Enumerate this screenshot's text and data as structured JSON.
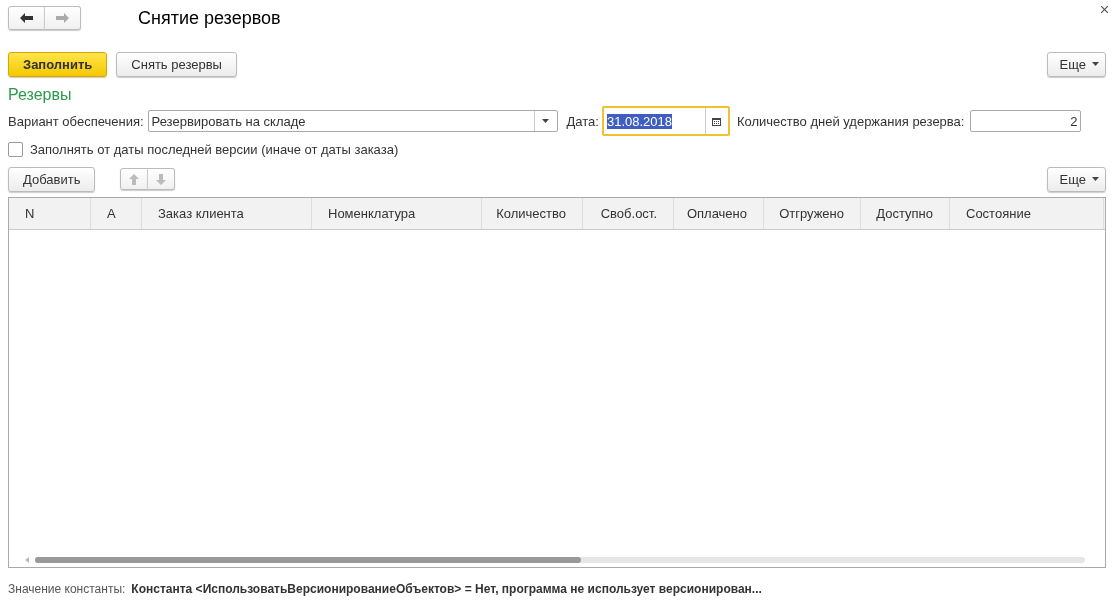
{
  "window": {
    "title": "Снятие резервов"
  },
  "toolbar": {
    "primary": "Заполнить",
    "secondary": "Снять резервы",
    "more": "Еще"
  },
  "section": {
    "title": "Резервы"
  },
  "fields": {
    "variant_label": "Вариант обеспечения:",
    "variant_value": "Резервировать на складе",
    "date_label": "Дата:",
    "date_value": "31.08.2018",
    "days_label": "Количество дней удержания резерва:",
    "days_value": "2"
  },
  "checkbox": {
    "label": "Заполнять от даты последней версии (иначе от даты заказа)",
    "checked": false
  },
  "table_toolbar": {
    "add": "Добавить",
    "more": "Еще"
  },
  "table": {
    "columns": [
      "N",
      "A",
      "Заказ клиента",
      "Номенклатура",
      "Количество",
      "Своб.ост.",
      "Оплачено",
      "Отгружено",
      "Доступно",
      "Состояние"
    ]
  },
  "status": {
    "label": "Значение константы:",
    "value": "Константа <ИспользоватьВерсионированиеОбъектов> = Нет, программа не использует версионирован..."
  }
}
